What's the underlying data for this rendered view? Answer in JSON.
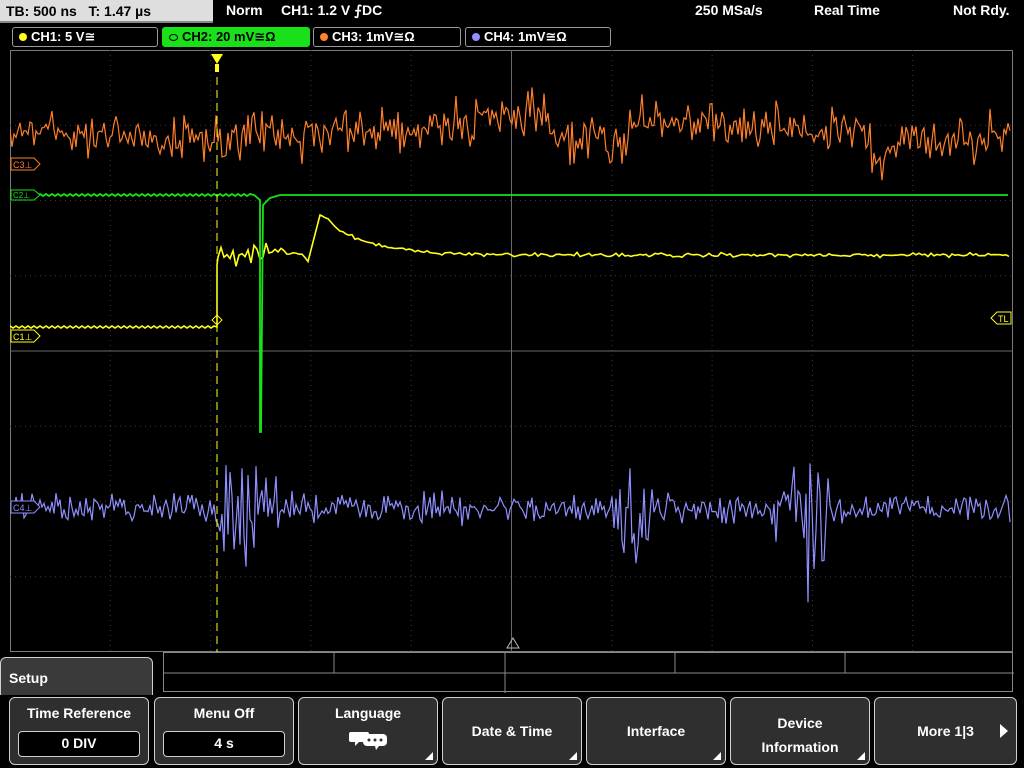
{
  "status": {
    "timebase": "TB: 500 ns",
    "trigger_time": "T: 1.47 µs",
    "mode": "Norm",
    "trigger_info": "CH1: 1.2 V ⨍DC",
    "sample_rate": "250 MSa/s",
    "acq_mode": "Real Time",
    "ready": "Not Rdy."
  },
  "channels": [
    {
      "label": "CH1: 5 V≅",
      "color": "#ffff1a",
      "active": false
    },
    {
      "label": "CH2: 20 mV≅Ω",
      "color": "#19e019",
      "active": true
    },
    {
      "label": "CH3: 1mV≅Ω",
      "color": "#ff7f2a",
      "active": false
    },
    {
      "label": "CH4: 1mV≅Ω",
      "color": "#8f8fff",
      "active": false
    }
  ],
  "markers": {
    "c3": "C3⊥",
    "c2": "C2⊥",
    "c1": "C1⊥",
    "c4": "C4⊥",
    "trigger_level": "TL"
  },
  "menu": {
    "title": "Setup",
    "softkeys": [
      {
        "label": "Time Reference",
        "value": "0 DIV"
      },
      {
        "label": "Menu Off",
        "value": "4 s"
      },
      {
        "label": "Language",
        "icon": "speech-bubble-icon"
      },
      {
        "label": "Date & Time"
      },
      {
        "label": "Interface"
      },
      {
        "label": "Device Information"
      },
      {
        "label": "More 1|3"
      }
    ]
  }
}
